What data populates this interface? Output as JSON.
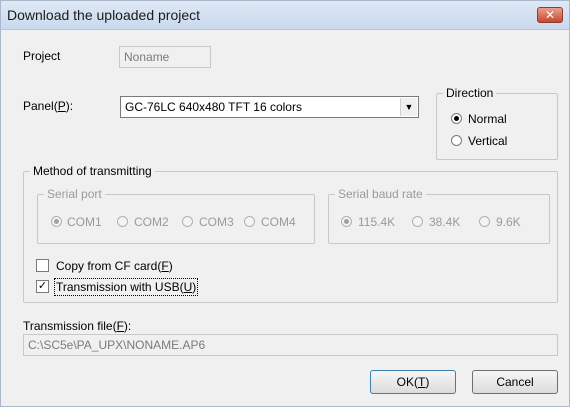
{
  "window": {
    "title": "Download the uploaded project",
    "close_glyph": "✕"
  },
  "project": {
    "label": "Project",
    "value": "Noname"
  },
  "panel": {
    "label_pre": "Panel(",
    "label_key": "P",
    "label_post": "):",
    "selected": "GC-76LC 640x480 TFT 16 colors",
    "arrow_glyph": "▼"
  },
  "direction": {
    "legend": "Direction",
    "options": [
      {
        "label": "Normal",
        "checked": true
      },
      {
        "label": "Vertical",
        "checked": false
      }
    ]
  },
  "method": {
    "legend": "Method of transmitting",
    "serial_port": {
      "legend": "Serial port",
      "options": [
        {
          "label": "COM1",
          "checked": true
        },
        {
          "label": "COM2",
          "checked": false
        },
        {
          "label": "COM3",
          "checked": false
        },
        {
          "label": "COM4",
          "checked": false
        }
      ]
    },
    "baud": {
      "legend": "Serial baud rate",
      "options": [
        {
          "label": "115.4K",
          "checked": true
        },
        {
          "label": "38.4K",
          "checked": false
        },
        {
          "label": "9.6K",
          "checked": false
        }
      ]
    },
    "cf_card": {
      "label_pre": "Copy from CF card(",
      "label_key": "F",
      "label_post": ")",
      "checked": false,
      "glyph": ""
    },
    "usb": {
      "label_pre": "Transmission with USB(",
      "label_key": "U",
      "label_post": ")",
      "checked": true,
      "glyph": "✓"
    }
  },
  "transmission_file": {
    "label_pre": "Transmission file(",
    "label_key": "F",
    "label_post": "):",
    "value": "C:\\SC5e\\PA_UPX\\NONAME.AP6"
  },
  "buttons": {
    "ok": {
      "label_pre": "OK(",
      "label_key": "T",
      "label_post": ")"
    },
    "cancel": {
      "label": "Cancel"
    }
  }
}
